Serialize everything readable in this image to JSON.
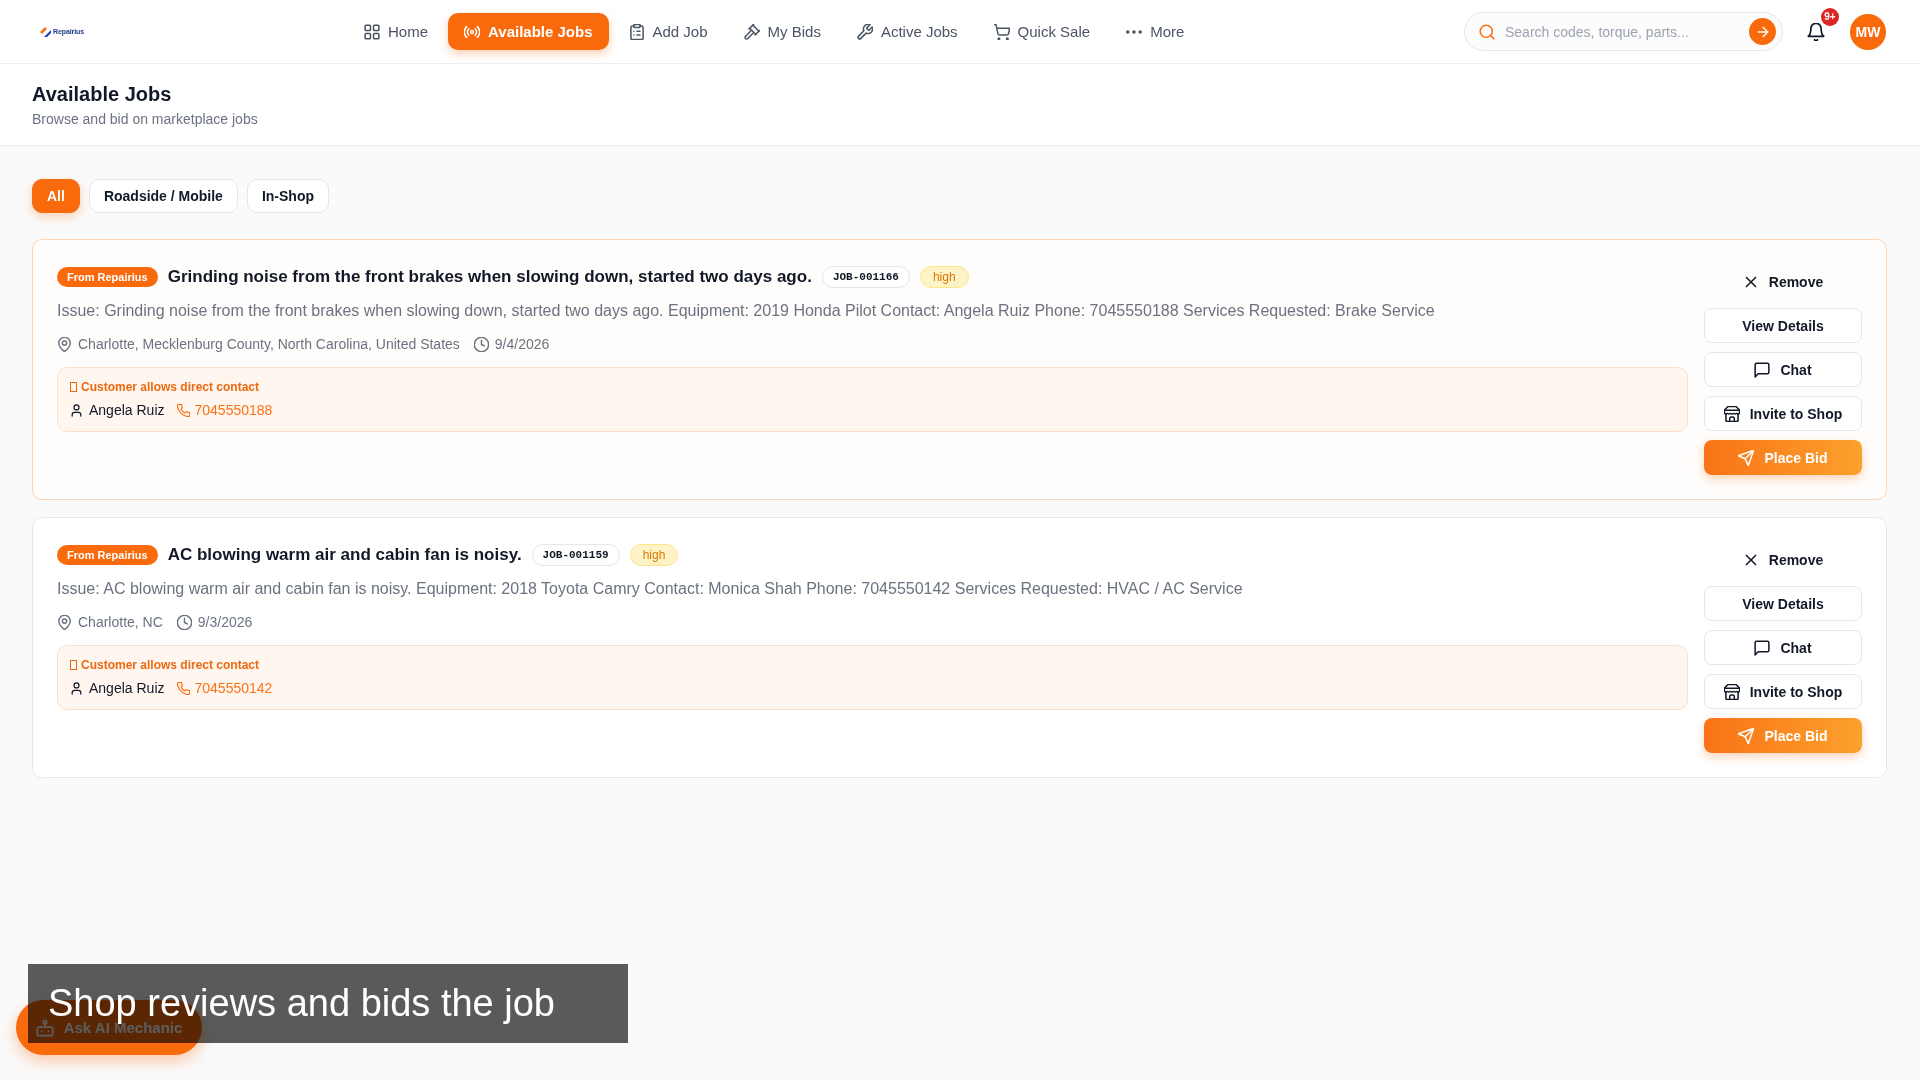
{
  "nav": {
    "logo": "Repairius",
    "items": [
      {
        "label": "Home",
        "selected": false
      },
      {
        "label": "Available Jobs",
        "selected": true
      },
      {
        "label": "Add Job",
        "selected": false
      },
      {
        "label": "My Bids",
        "selected": false
      },
      {
        "label": "Active Jobs",
        "selected": false
      },
      {
        "label": "Quick Sale",
        "selected": false
      },
      {
        "label": "More",
        "selected": false
      }
    ],
    "search": {
      "placeholder": "Search codes, torque, parts..."
    },
    "notifications": "9+",
    "user_initials": "MW"
  },
  "header": {
    "title": "Available Jobs",
    "subtitle": "Browse and bid on marketplace jobs"
  },
  "filters": [
    {
      "label": "All",
      "selected": true
    },
    {
      "label": "Roadside / Mobile",
      "selected": false
    },
    {
      "label": "In-Shop",
      "selected": false
    }
  ],
  "jobs": [
    {
      "selected": true,
      "source": "From Repairius",
      "title": "Grinding noise from the front brakes when slowing down, started two days ago.",
      "job_id": "JOB-001166",
      "priority": "high",
      "description": "Issue: Grinding noise from the front brakes when slowing down, started two days ago. Equipment: 2019 Honda Pilot Contact: Angela Ruiz Phone: 7045550188 Services Requested: Brake Service",
      "location": "Charlotte, Mecklenburg County, North Carolina, United States",
      "date": "9/4/2026",
      "contact": {
        "note": "Customer allows direct contact",
        "name": "Angela Ruiz",
        "phone": "7045550188"
      },
      "actions": [
        {
          "label": "Remove",
          "kind": "ghost"
        },
        {
          "label": "View Details",
          "kind": "outline"
        },
        {
          "label": "Chat",
          "kind": "outline"
        },
        {
          "label": "Invite to Shop",
          "kind": "outline"
        },
        {
          "label": "Place Bid",
          "kind": "primary"
        }
      ]
    },
    {
      "selected": false,
      "source": "From Repairius",
      "title": "AC blowing warm air and cabin fan is noisy.",
      "job_id": "JOB-001159",
      "priority": "high",
      "description": "Issue: AC blowing warm air and cabin fan is noisy. Equipment: 2018 Toyota Camry Contact: Monica Shah Phone: 7045550142 Services Requested: HVAC / AC Service",
      "location": "Charlotte, NC",
      "date": "9/3/2026",
      "contact": {
        "note": "Customer allows direct contact",
        "name": "Angela Ruiz",
        "phone": "7045550142"
      },
      "actions": [
        {
          "label": "Remove",
          "kind": "ghost"
        },
        {
          "label": "View Details",
          "kind": "outline"
        },
        {
          "label": "Chat",
          "kind": "outline"
        },
        {
          "label": "Invite to Shop",
          "kind": "outline"
        },
        {
          "label": "Place Bid",
          "kind": "primary"
        }
      ]
    }
  ],
  "ai_button": {
    "label": "Ask AI Mechanic"
  },
  "caption": "Shop reviews and bids the job"
}
